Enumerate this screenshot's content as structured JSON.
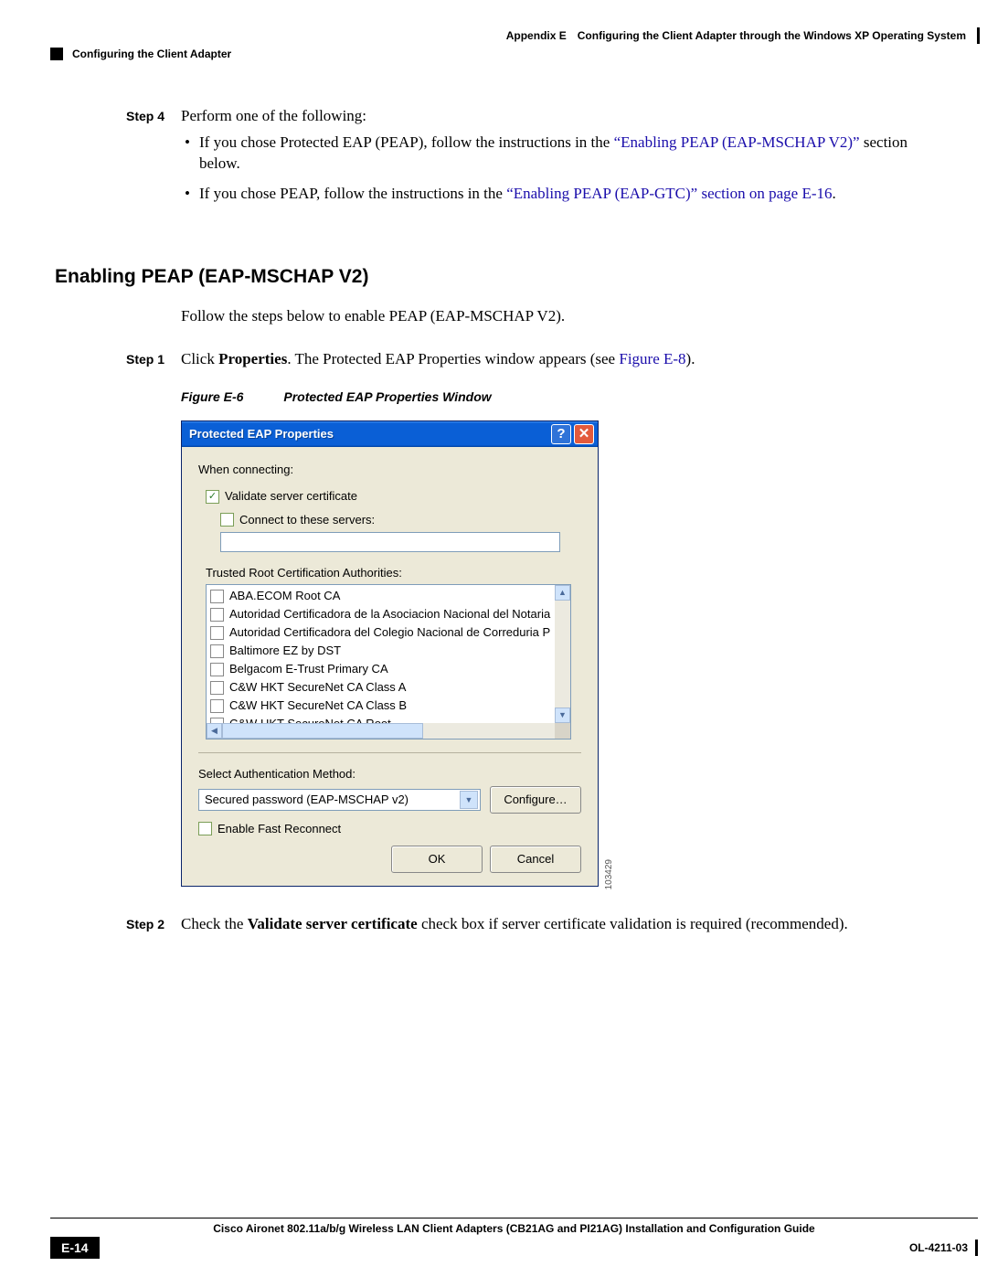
{
  "header": {
    "appendix": "Appendix E",
    "title": "Configuring the Client Adapter through the Windows XP Operating System",
    "subheader": "Configuring the Client Adapter"
  },
  "step4": {
    "label": "Step 4",
    "intro": "Perform one of the following:",
    "bullet1_pre": "If you chose Protected EAP (PEAP), follow the instructions in the ",
    "bullet1_link": "“Enabling PEAP (EAP-MSCHAP V2)”",
    "bullet1_post": " section below.",
    "bullet2_pre": "If you chose PEAP, follow the instructions in the ",
    "bullet2_link": "“Enabling PEAP (EAP-GTC)” section on page E-16",
    "bullet2_post": "."
  },
  "section_heading": "Enabling PEAP (EAP-MSCHAP V2)",
  "section_intro": "Follow the steps below to enable PEAP (EAP-MSCHAP V2).",
  "step1": {
    "label": "Step 1",
    "pre": "Click ",
    "bold": "Properties",
    "mid": ". The Protected EAP Properties window appears (see ",
    "link": "Figure E-8",
    "post": ")."
  },
  "figure": {
    "num": "Figure E-6",
    "caption": "Protected EAP Properties Window",
    "id": "103429"
  },
  "dialog": {
    "title": "Protected EAP Properties",
    "when_connecting": "When connecting:",
    "validate_server": "Validate server certificate",
    "connect_servers": "Connect to these servers:",
    "trusted_label": "Trusted Root Certification Authorities:",
    "cas": [
      "ABA.ECOM Root CA",
      "Autoridad Certificadora de la Asociacion Nacional del Notaria",
      "Autoridad Certificadora del Colegio Nacional de Correduria P",
      "Baltimore EZ by DST",
      "Belgacom E-Trust Primary CA",
      "C&W HKT SecureNet CA Class A",
      "C&W HKT SecureNet CA Class B",
      "C&W HKT SecureNet CA Root"
    ],
    "select_auth_label": "Select Authentication Method:",
    "auth_method": "Secured password (EAP-MSCHAP v2)",
    "configure": "Configure…",
    "fast_reconnect": "Enable Fast Reconnect",
    "ok": "OK",
    "cancel": "Cancel"
  },
  "step2": {
    "label": "Step 2",
    "pre": "Check the ",
    "bold": "Validate server certificate",
    "post": " check box if server certificate validation is required (recommended)."
  },
  "footer": {
    "guide": "Cisco Aironet 802.11a/b/g Wireless LAN Client Adapters (CB21AG and PI21AG) Installation and Configuration Guide",
    "page": "E-14",
    "docid": "OL-4211-03"
  }
}
